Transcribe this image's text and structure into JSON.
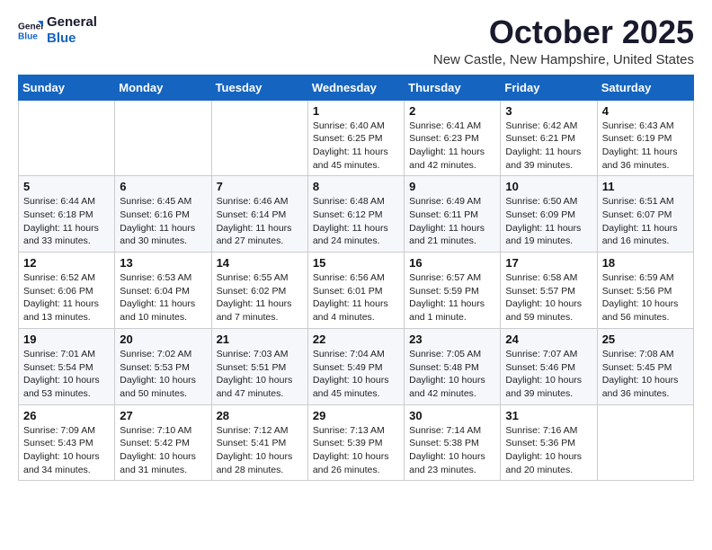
{
  "logo": {
    "line1": "General",
    "line2": "Blue"
  },
  "title": "October 2025",
  "location": "New Castle, New Hampshire, United States",
  "days_of_week": [
    "Sunday",
    "Monday",
    "Tuesday",
    "Wednesday",
    "Thursday",
    "Friday",
    "Saturday"
  ],
  "weeks": [
    [
      {
        "day": "",
        "info": ""
      },
      {
        "day": "",
        "info": ""
      },
      {
        "day": "",
        "info": ""
      },
      {
        "day": "1",
        "info": "Sunrise: 6:40 AM\nSunset: 6:25 PM\nDaylight: 11 hours\nand 45 minutes."
      },
      {
        "day": "2",
        "info": "Sunrise: 6:41 AM\nSunset: 6:23 PM\nDaylight: 11 hours\nand 42 minutes."
      },
      {
        "day": "3",
        "info": "Sunrise: 6:42 AM\nSunset: 6:21 PM\nDaylight: 11 hours\nand 39 minutes."
      },
      {
        "day": "4",
        "info": "Sunrise: 6:43 AM\nSunset: 6:19 PM\nDaylight: 11 hours\nand 36 minutes."
      }
    ],
    [
      {
        "day": "5",
        "info": "Sunrise: 6:44 AM\nSunset: 6:18 PM\nDaylight: 11 hours\nand 33 minutes."
      },
      {
        "day": "6",
        "info": "Sunrise: 6:45 AM\nSunset: 6:16 PM\nDaylight: 11 hours\nand 30 minutes."
      },
      {
        "day": "7",
        "info": "Sunrise: 6:46 AM\nSunset: 6:14 PM\nDaylight: 11 hours\nand 27 minutes."
      },
      {
        "day": "8",
        "info": "Sunrise: 6:48 AM\nSunset: 6:12 PM\nDaylight: 11 hours\nand 24 minutes."
      },
      {
        "day": "9",
        "info": "Sunrise: 6:49 AM\nSunset: 6:11 PM\nDaylight: 11 hours\nand 21 minutes."
      },
      {
        "day": "10",
        "info": "Sunrise: 6:50 AM\nSunset: 6:09 PM\nDaylight: 11 hours\nand 19 minutes."
      },
      {
        "day": "11",
        "info": "Sunrise: 6:51 AM\nSunset: 6:07 PM\nDaylight: 11 hours\nand 16 minutes."
      }
    ],
    [
      {
        "day": "12",
        "info": "Sunrise: 6:52 AM\nSunset: 6:06 PM\nDaylight: 11 hours\nand 13 minutes."
      },
      {
        "day": "13",
        "info": "Sunrise: 6:53 AM\nSunset: 6:04 PM\nDaylight: 11 hours\nand 10 minutes."
      },
      {
        "day": "14",
        "info": "Sunrise: 6:55 AM\nSunset: 6:02 PM\nDaylight: 11 hours\nand 7 minutes."
      },
      {
        "day": "15",
        "info": "Sunrise: 6:56 AM\nSunset: 6:01 PM\nDaylight: 11 hours\nand 4 minutes."
      },
      {
        "day": "16",
        "info": "Sunrise: 6:57 AM\nSunset: 5:59 PM\nDaylight: 11 hours\nand 1 minute."
      },
      {
        "day": "17",
        "info": "Sunrise: 6:58 AM\nSunset: 5:57 PM\nDaylight: 10 hours\nand 59 minutes."
      },
      {
        "day": "18",
        "info": "Sunrise: 6:59 AM\nSunset: 5:56 PM\nDaylight: 10 hours\nand 56 minutes."
      }
    ],
    [
      {
        "day": "19",
        "info": "Sunrise: 7:01 AM\nSunset: 5:54 PM\nDaylight: 10 hours\nand 53 minutes."
      },
      {
        "day": "20",
        "info": "Sunrise: 7:02 AM\nSunset: 5:53 PM\nDaylight: 10 hours\nand 50 minutes."
      },
      {
        "day": "21",
        "info": "Sunrise: 7:03 AM\nSunset: 5:51 PM\nDaylight: 10 hours\nand 47 minutes."
      },
      {
        "day": "22",
        "info": "Sunrise: 7:04 AM\nSunset: 5:49 PM\nDaylight: 10 hours\nand 45 minutes."
      },
      {
        "day": "23",
        "info": "Sunrise: 7:05 AM\nSunset: 5:48 PM\nDaylight: 10 hours\nand 42 minutes."
      },
      {
        "day": "24",
        "info": "Sunrise: 7:07 AM\nSunset: 5:46 PM\nDaylight: 10 hours\nand 39 minutes."
      },
      {
        "day": "25",
        "info": "Sunrise: 7:08 AM\nSunset: 5:45 PM\nDaylight: 10 hours\nand 36 minutes."
      }
    ],
    [
      {
        "day": "26",
        "info": "Sunrise: 7:09 AM\nSunset: 5:43 PM\nDaylight: 10 hours\nand 34 minutes."
      },
      {
        "day": "27",
        "info": "Sunrise: 7:10 AM\nSunset: 5:42 PM\nDaylight: 10 hours\nand 31 minutes."
      },
      {
        "day": "28",
        "info": "Sunrise: 7:12 AM\nSunset: 5:41 PM\nDaylight: 10 hours\nand 28 minutes."
      },
      {
        "day": "29",
        "info": "Sunrise: 7:13 AM\nSunset: 5:39 PM\nDaylight: 10 hours\nand 26 minutes."
      },
      {
        "day": "30",
        "info": "Sunrise: 7:14 AM\nSunset: 5:38 PM\nDaylight: 10 hours\nand 23 minutes."
      },
      {
        "day": "31",
        "info": "Sunrise: 7:16 AM\nSunset: 5:36 PM\nDaylight: 10 hours\nand 20 minutes."
      },
      {
        "day": "",
        "info": ""
      }
    ]
  ]
}
